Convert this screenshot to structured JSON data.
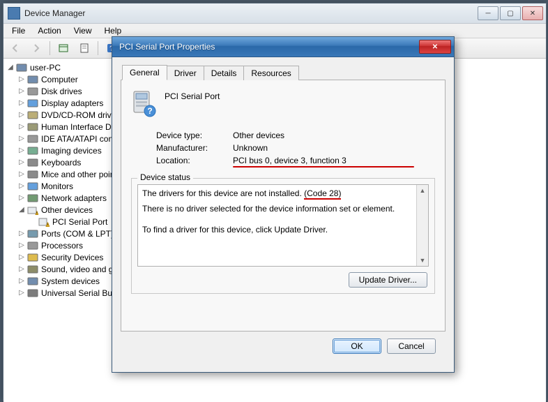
{
  "main": {
    "title": "Device Manager",
    "menu": [
      "File",
      "Action",
      "View",
      "Help"
    ]
  },
  "tree": {
    "root": "user-PC",
    "nodes": [
      {
        "label": "Computer",
        "icon": "computer"
      },
      {
        "label": "Disk drives",
        "icon": "disk"
      },
      {
        "label": "Display adapters",
        "icon": "display"
      },
      {
        "label": "DVD/CD-ROM drives",
        "icon": "cd"
      },
      {
        "label": "Human Interface Devices",
        "icon": "hid"
      },
      {
        "label": "IDE ATA/ATAPI controllers",
        "icon": "ide"
      },
      {
        "label": "Imaging devices",
        "icon": "imaging"
      },
      {
        "label": "Keyboards",
        "icon": "keyboard"
      },
      {
        "label": "Mice and other pointing devices",
        "icon": "mouse"
      },
      {
        "label": "Monitors",
        "icon": "monitor"
      },
      {
        "label": "Network adapters",
        "icon": "network"
      },
      {
        "label": "Other devices",
        "icon": "warn",
        "expanded": true,
        "children": [
          {
            "label": "PCI Serial Port",
            "icon": "warn-dev"
          }
        ]
      },
      {
        "label": "Ports (COM & LPT)",
        "icon": "port"
      },
      {
        "label": "Processors",
        "icon": "cpu"
      },
      {
        "label": "Security Devices",
        "icon": "security"
      },
      {
        "label": "Sound, video and game controllers",
        "icon": "sound"
      },
      {
        "label": "System devices",
        "icon": "system"
      },
      {
        "label": "Universal Serial Bus controllers",
        "icon": "usb"
      }
    ]
  },
  "dialog": {
    "title": "PCI Serial Port Properties",
    "tabs": [
      "General",
      "Driver",
      "Details",
      "Resources"
    ],
    "active_tab": "General",
    "device_name": "PCI Serial Port",
    "rows": {
      "type_label": "Device type:",
      "type_value": "Other devices",
      "mfr_label": "Manufacturer:",
      "mfr_value": "Unknown",
      "loc_label": "Location:",
      "loc_value": "PCI bus 0, device 3, function 3"
    },
    "status_title": "Device status",
    "status_line1_a": "The drivers for this device are not installed. ",
    "status_line1_b": "(Code 28)",
    "status_line2": "There is no driver selected for the device information set or element.",
    "status_line3": "To find a driver for this device, click Update Driver.",
    "update_btn": "Update Driver...",
    "ok": "OK",
    "cancel": "Cancel"
  }
}
